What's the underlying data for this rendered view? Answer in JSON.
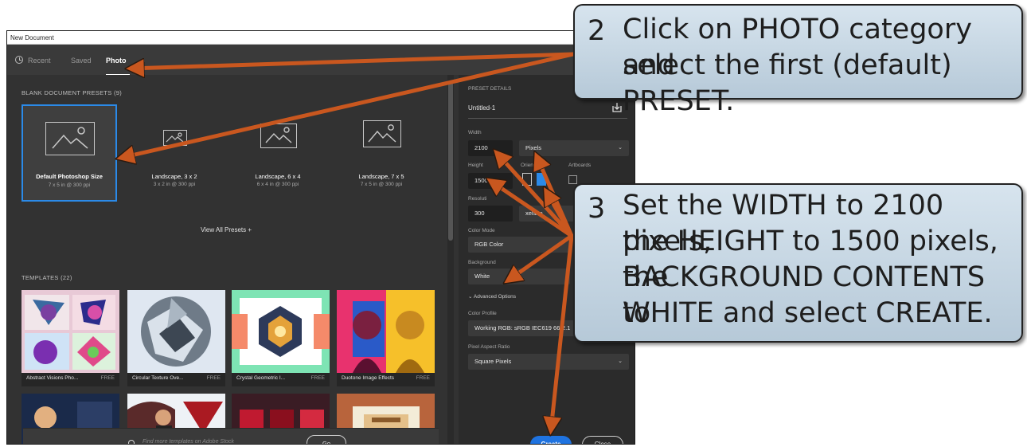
{
  "window": {
    "title": "New Document"
  },
  "tabs": [
    {
      "label": "Recent"
    },
    {
      "label": "Saved"
    },
    {
      "label": "Photo"
    }
  ],
  "presets_section": {
    "label": "BLANK DOCUMENT PRESETS  (9)"
  },
  "presets": [
    {
      "name": "Default Photoshop Size",
      "size": "7 x 5 in @ 300 ppi"
    },
    {
      "name": "Landscape, 3 x 2",
      "size": "3 x 2 in @ 300 ppi"
    },
    {
      "name": "Landscape, 6 x 4",
      "size": "6 x 4 in @ 300 ppi"
    },
    {
      "name": "Landscape, 7 x 5",
      "size": "7 x 5 in @ 300 ppi"
    }
  ],
  "view_all": "View All Presets +",
  "templates_section": {
    "label": "TEMPLATES  (22)"
  },
  "templates": [
    {
      "name": "Abstract Visions Pho...",
      "badge": "FREE"
    },
    {
      "name": "Circular Texture Ove...",
      "badge": "FREE"
    },
    {
      "name": "Crystal Geometric I...",
      "badge": "FREE"
    },
    {
      "name": "Duotone Image Effects",
      "badge": "FREE"
    }
  ],
  "search": {
    "placeholder": "Find more templates on Adobe Stock",
    "go_label": "Go"
  },
  "details": {
    "header": "PRESET DETAILS",
    "doc_name": "Untitled-1",
    "width_label": "Width",
    "width_value": "2100",
    "width_unit": "Pixels",
    "height_label": "Height",
    "height_value": "1500",
    "orientation_label": "Orienta",
    "artboards_label": "Artboards",
    "resolution_label": "Resoluti",
    "resolution_value": "300",
    "resolution_unit": "xels/In",
    "color_mode_label": "Color Mode",
    "color_mode_value": "RGB Color",
    "background_label": "Background",
    "background_value": "White",
    "advanced_label": "Advanced Options",
    "color_profile_label": "Color Profile",
    "color_profile_value": "Working RGB: sRGB IEC619 66-2.1",
    "pixel_aspect_label": "Pixel Aspect Ratio",
    "pixel_aspect_value": "Square Pixels",
    "create_label": "Create",
    "close_label": "Close"
  },
  "callouts": [
    {
      "number": "2",
      "lines": [
        "Click on PHOTO category and",
        "select the first (default) PRESET."
      ]
    },
    {
      "number": "3",
      "lines": [
        "Set the WIDTH to 2100 pixels,",
        "the HEIGHT to 1500 pixels, the",
        "BACKGROUND CONTENTS to",
        "WHITE and select CREATE."
      ]
    }
  ],
  "colors": {
    "accent": "#2b8ae8",
    "arrow": "#c9571f",
    "callout": "#c8d8e6",
    "panel": "#323232"
  }
}
